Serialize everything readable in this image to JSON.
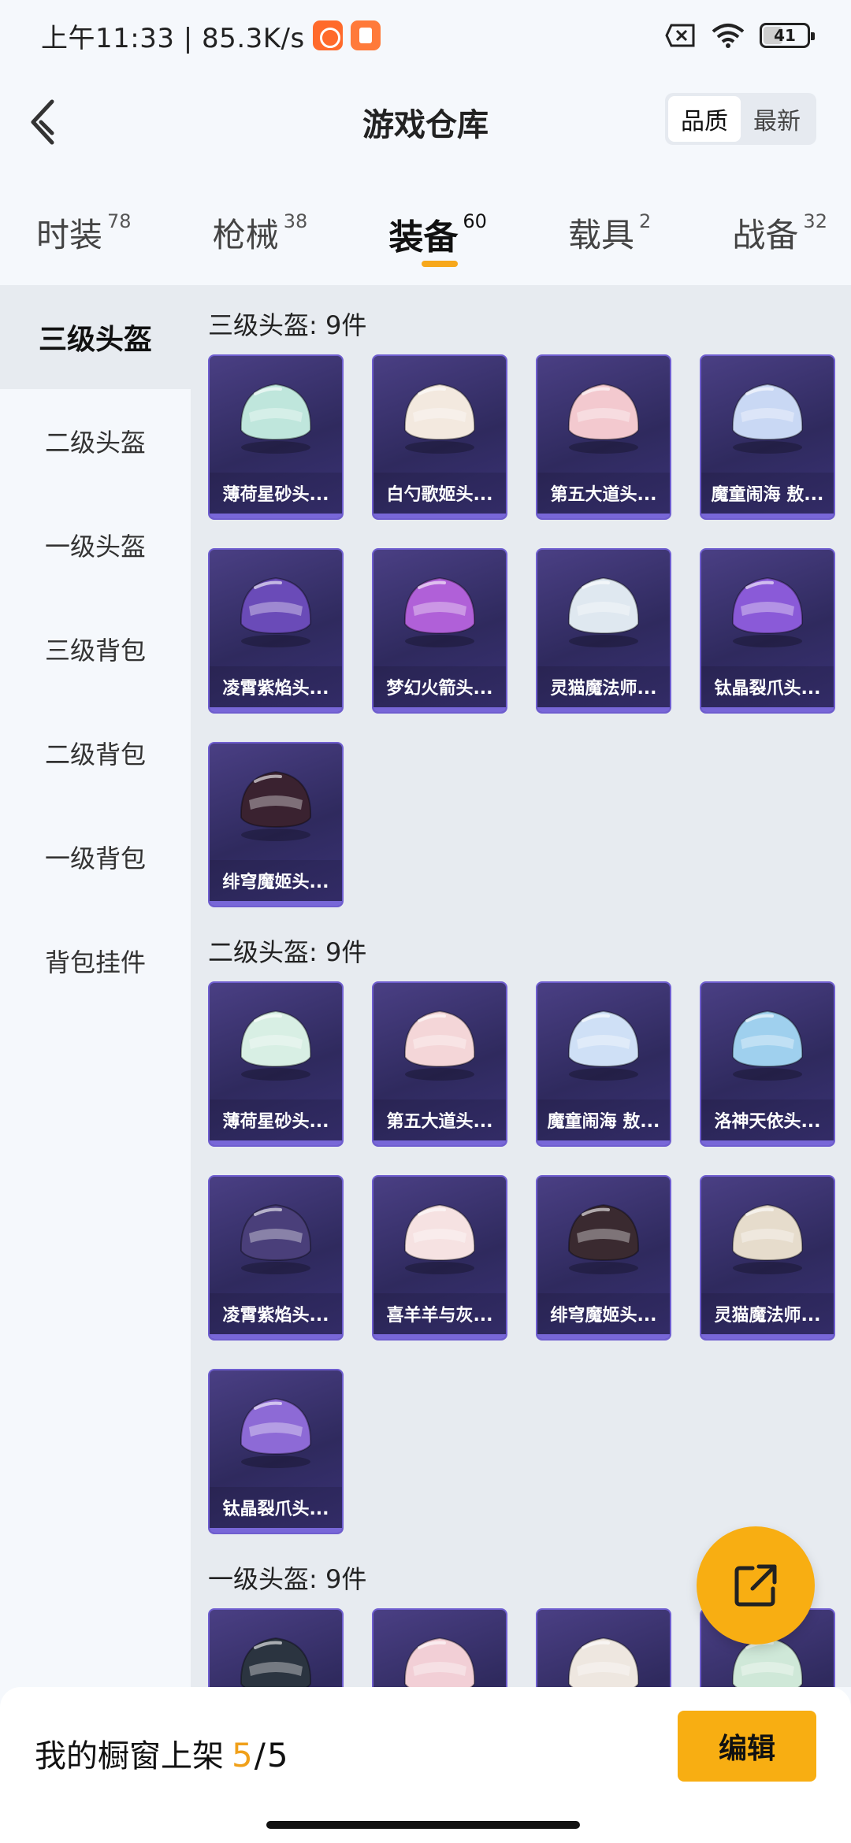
{
  "status_bar": {
    "time_speed": "上午11:33 | 85.3K/s",
    "battery": "41",
    "battery_level": 0.41
  },
  "header": {
    "title": "游戏仓库",
    "sort_options": [
      {
        "label": "品质",
        "active": true
      },
      {
        "label": "最新",
        "active": false
      }
    ]
  },
  "tabs": [
    {
      "label": "时装",
      "count": "78",
      "active": false
    },
    {
      "label": "枪械",
      "count": "38",
      "active": false
    },
    {
      "label": "装备",
      "count": "60",
      "active": true
    },
    {
      "label": "载具",
      "count": "2",
      "active": false
    },
    {
      "label": "战备",
      "count": "32",
      "active": false
    }
  ],
  "sidebar": {
    "items": [
      {
        "label": "三级头盔",
        "active": true
      },
      {
        "label": "二级头盔",
        "active": false
      },
      {
        "label": "一级头盔",
        "active": false
      },
      {
        "label": "三级背包",
        "active": false
      },
      {
        "label": "二级背包",
        "active": false
      },
      {
        "label": "一级背包",
        "active": false
      },
      {
        "label": "背包挂件",
        "active": false
      }
    ]
  },
  "sections": [
    {
      "title": "三级头盔: 9件",
      "items": [
        {
          "name": "薄荷星砂头...",
          "color": "#bfe6dc"
        },
        {
          "name": "白勺歌姬头...",
          "color": "#f3e9df"
        },
        {
          "name": "第五大道头...",
          "color": "#f3c9cf"
        },
        {
          "name": "魔童闹海 敖...",
          "color": "#c9d8f4"
        },
        {
          "name": "凌霄紫焰头...",
          "color": "#6a4bb8"
        },
        {
          "name": "梦幻火箭头...",
          "color": "#b060d8"
        },
        {
          "name": "灵猫魔法师...",
          "color": "#dfe8f0"
        },
        {
          "name": "钛晶裂爪头...",
          "color": "#8a5ad8"
        },
        {
          "name": "绯穹魔姬头...",
          "color": "#3a2230"
        }
      ]
    },
    {
      "title": "二级头盔: 9件",
      "items": [
        {
          "name": "薄荷星砂头...",
          "color": "#d8efe4"
        },
        {
          "name": "第五大道头...",
          "color": "#f4d6d8"
        },
        {
          "name": "魔童闹海 敖...",
          "color": "#cfe0f6"
        },
        {
          "name": "洛神天依头...",
          "color": "#9fd0ee"
        },
        {
          "name": "凌霄紫焰头...",
          "color": "#4a3f7a"
        },
        {
          "name": "喜羊羊与灰...",
          "color": "#f6e2e2"
        },
        {
          "name": "绯穹魔姬头...",
          "color": "#3a2a30"
        },
        {
          "name": "灵猫魔法师...",
          "color": "#e6dccc"
        },
        {
          "name": "钛晶裂爪头...",
          "color": "#8d6ad6"
        }
      ]
    },
    {
      "title": "一级头盔: 9件",
      "items": [
        {
          "name": "",
          "color": "#2b3440"
        },
        {
          "name": "",
          "color": "#f2cfd6"
        },
        {
          "name": "",
          "color": "#eee7e0"
        },
        {
          "name": "",
          "color": "#cfe8d8"
        }
      ]
    }
  ],
  "bottom": {
    "shelf_label": "我的橱窗上架",
    "shelf_count": "5",
    "shelf_sep": "/",
    "shelf_total": "5",
    "edit_label": "编辑"
  },
  "colors": {
    "accent": "#f8ae12",
    "card_bg": "#3a3276"
  }
}
